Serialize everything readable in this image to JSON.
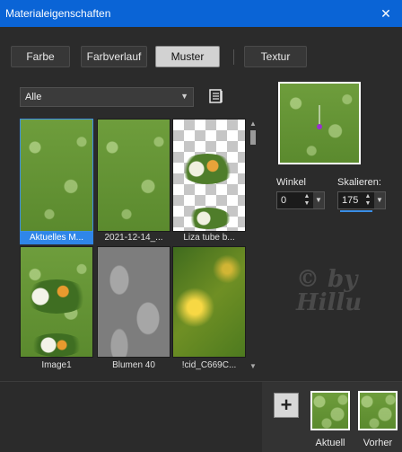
{
  "window": {
    "title": "Materialeigenschaften",
    "close_glyph": "✕"
  },
  "tabs": [
    {
      "label": "Farbe",
      "active": false
    },
    {
      "label": "Farbverlauf",
      "active": false
    },
    {
      "label": "Muster",
      "active": true
    },
    {
      "label": "Textur",
      "active": false
    }
  ],
  "library": {
    "dropdown_value": "Alle",
    "book_icon": "book-icon"
  },
  "patterns": [
    {
      "caption": "Aktuelles M...",
      "selected": true
    },
    {
      "caption": "2021-12-14_...",
      "selected": false
    },
    {
      "caption": "Liza tube b...",
      "selected": false
    },
    {
      "caption": "Image1",
      "selected": false
    },
    {
      "caption": "Blumen 40",
      "selected": false
    },
    {
      "caption": "!cid_C669C...",
      "selected": false
    }
  ],
  "settings": {
    "angle_label": "Winkel",
    "angle_value": "0",
    "scale_label": "Skalieren:",
    "scale_value": "175"
  },
  "watermark": {
    "line1": "© by",
    "line2": "Hillu"
  },
  "swatches": {
    "add_label": "+",
    "current_label": "Aktuell",
    "previous_label": "Vorher"
  },
  "colors": {
    "accent": "#0a64d6",
    "selection": "#2f86e8"
  }
}
